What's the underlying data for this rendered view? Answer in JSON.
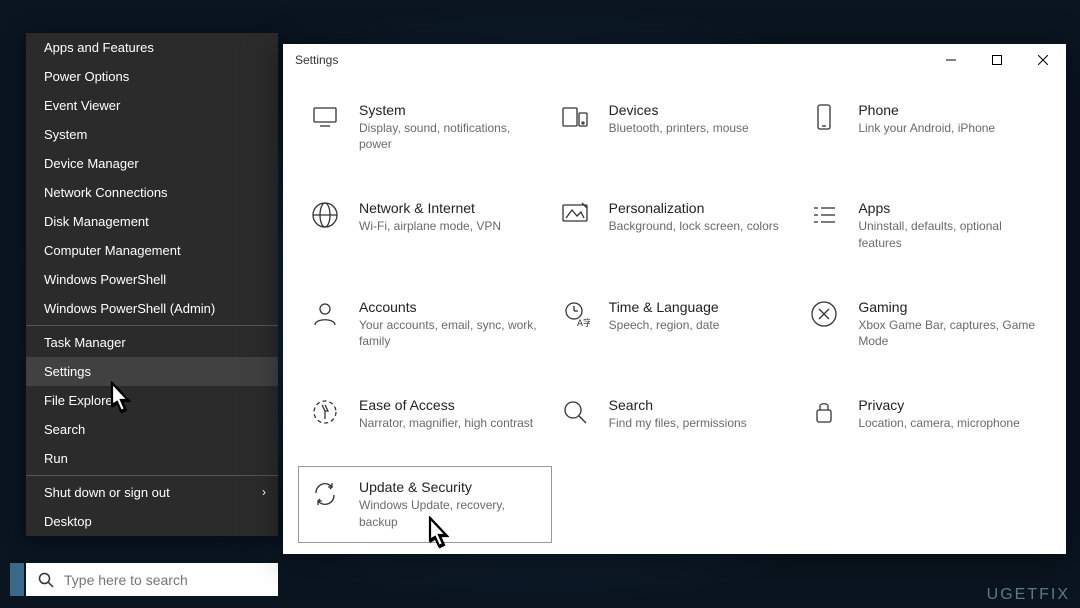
{
  "watermark": "UGETFIX",
  "context_menu": {
    "groups": [
      [
        "Apps and Features",
        "Power Options",
        "Event Viewer",
        "System",
        "Device Manager",
        "Network Connections",
        "Disk Management",
        "Computer Management",
        "Windows PowerShell",
        "Windows PowerShell (Admin)"
      ],
      [
        "Task Manager",
        "Settings",
        "File Explorer",
        "Search",
        "Run"
      ],
      [
        "Shut down or sign out",
        "Desktop"
      ]
    ],
    "hovered": "Settings",
    "submenu_items": [
      "Shut down or sign out"
    ]
  },
  "search": {
    "placeholder": "Type here to search"
  },
  "settings_window": {
    "title": "Settings",
    "categories": [
      {
        "key": "system",
        "title": "System",
        "desc": "Display, sound, notifications, power"
      },
      {
        "key": "devices",
        "title": "Devices",
        "desc": "Bluetooth, printers, mouse"
      },
      {
        "key": "phone",
        "title": "Phone",
        "desc": "Link your Android, iPhone"
      },
      {
        "key": "network",
        "title": "Network & Internet",
        "desc": "Wi-Fi, airplane mode, VPN"
      },
      {
        "key": "personalization",
        "title": "Personalization",
        "desc": "Background, lock screen, colors"
      },
      {
        "key": "apps",
        "title": "Apps",
        "desc": "Uninstall, defaults, optional features"
      },
      {
        "key": "accounts",
        "title": "Accounts",
        "desc": "Your accounts, email, sync, work, family"
      },
      {
        "key": "time",
        "title": "Time & Language",
        "desc": "Speech, region, date"
      },
      {
        "key": "gaming",
        "title": "Gaming",
        "desc": "Xbox Game Bar, captures, Game Mode"
      },
      {
        "key": "ease",
        "title": "Ease of Access",
        "desc": "Narrator, magnifier, high contrast"
      },
      {
        "key": "search",
        "title": "Search",
        "desc": "Find my files, permissions"
      },
      {
        "key": "privacy",
        "title": "Privacy",
        "desc": "Location, camera, microphone"
      },
      {
        "key": "update",
        "title": "Update & Security",
        "desc": "Windows Update, recovery, backup"
      }
    ],
    "selected": "update"
  }
}
